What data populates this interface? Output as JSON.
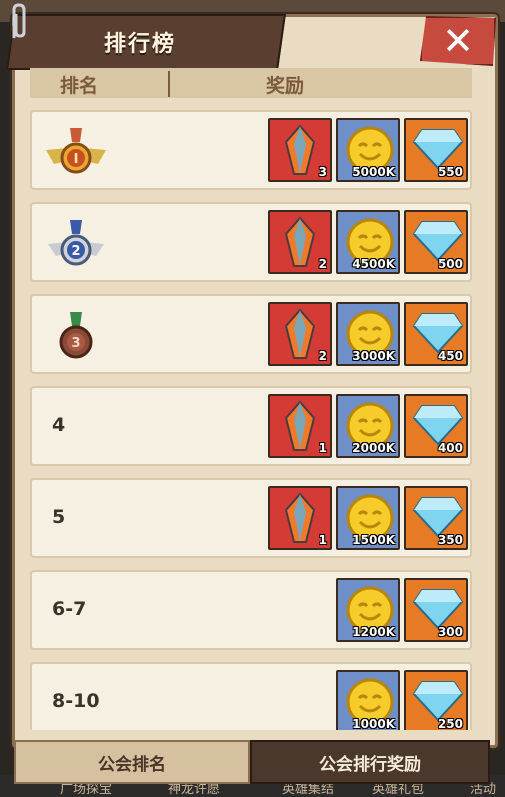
{
  "window": {
    "title": "排行榜",
    "close_label": "✕"
  },
  "table_header": {
    "rank": "排名",
    "reward": "奖励"
  },
  "rows": [
    {
      "rank": "1",
      "medal": "gold-medal-icon",
      "rewards": [
        {
          "type": "crystal",
          "qty": "3"
        },
        {
          "type": "coin",
          "qty": "5000K"
        },
        {
          "type": "diamond",
          "qty": "550"
        }
      ]
    },
    {
      "rank": "2",
      "medal": "silver-medal-icon",
      "rewards": [
        {
          "type": "crystal",
          "qty": "2"
        },
        {
          "type": "coin",
          "qty": "4500K"
        },
        {
          "type": "diamond",
          "qty": "500"
        }
      ]
    },
    {
      "rank": "3",
      "medal": "bronze-medal-icon",
      "rewards": [
        {
          "type": "crystal",
          "qty": "2"
        },
        {
          "type": "coin",
          "qty": "3000K"
        },
        {
          "type": "diamond",
          "qty": "450"
        }
      ]
    },
    {
      "rank": "4",
      "rewards": [
        {
          "type": "crystal",
          "qty": "1"
        },
        {
          "type": "coin",
          "qty": "2000K"
        },
        {
          "type": "diamond",
          "qty": "400"
        }
      ]
    },
    {
      "rank": "5",
      "rewards": [
        {
          "type": "crystal",
          "qty": "1"
        },
        {
          "type": "coin",
          "qty": "1500K"
        },
        {
          "type": "diamond",
          "qty": "350"
        }
      ]
    },
    {
      "rank": "6-7",
      "rewards": [
        {
          "type": "coin",
          "qty": "1200K"
        },
        {
          "type": "diamond",
          "qty": "300"
        }
      ]
    },
    {
      "rank": "8-10",
      "rewards": [
        {
          "type": "coin",
          "qty": "1000K"
        },
        {
          "type": "diamond",
          "qty": "250"
        }
      ]
    }
  ],
  "tabs": [
    {
      "label": "公会排名",
      "active": false
    },
    {
      "label": "公会排行奖励",
      "active": true
    }
  ],
  "background_bottom": [
    "广场探宝",
    "神龙许愿",
    "英雄集结",
    "英雄礼包",
    "活动"
  ],
  "colors": {
    "crystal_bg": "#d53b35",
    "coin_bg": "#6f8fc9",
    "diamond_bg": "#e67a25",
    "active_tab": "#4a382c"
  }
}
